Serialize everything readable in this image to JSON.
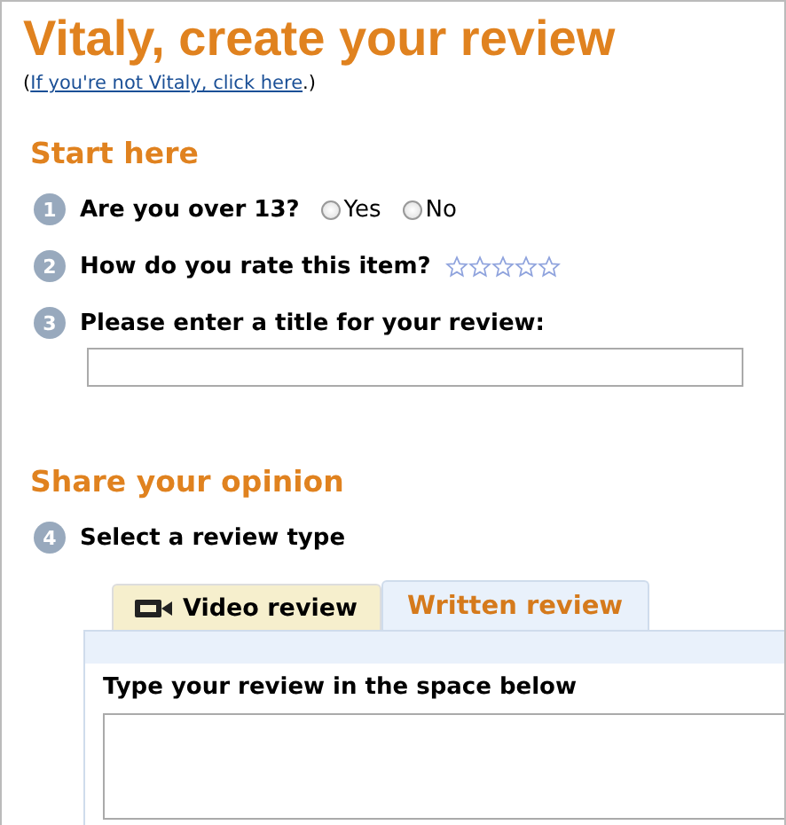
{
  "heading": "Vitaly, create your review",
  "switch_user": {
    "before": "(",
    "link": "If you're not Vitaly, click here",
    "after": ".)"
  },
  "sections": [
    {
      "title": "Start here",
      "steps": [
        {
          "number": "1",
          "kind": "radio",
          "label": "Are you over 13?",
          "options": [
            {
              "label": "Yes",
              "selected": false
            },
            {
              "label": "No",
              "selected": false
            }
          ]
        },
        {
          "number": "2",
          "kind": "stars",
          "label": "How do you rate this item?",
          "stars": 0
        },
        {
          "number": "3",
          "kind": "text",
          "label": "Please enter a title for your review:"
        }
      ]
    },
    {
      "title": "Share your opinion",
      "steps": [
        {
          "number": "4",
          "kind": "tabs",
          "label": "Select a review type",
          "tabs": [
            {
              "label": "Video review",
              "kind": "video",
              "selected": false
            },
            {
              "label": "Written review",
              "kind": "written",
              "selected": true
            }
          ],
          "panel": {
            "prompt": "Type your review in the space below"
          }
        }
      ]
    }
  ]
}
